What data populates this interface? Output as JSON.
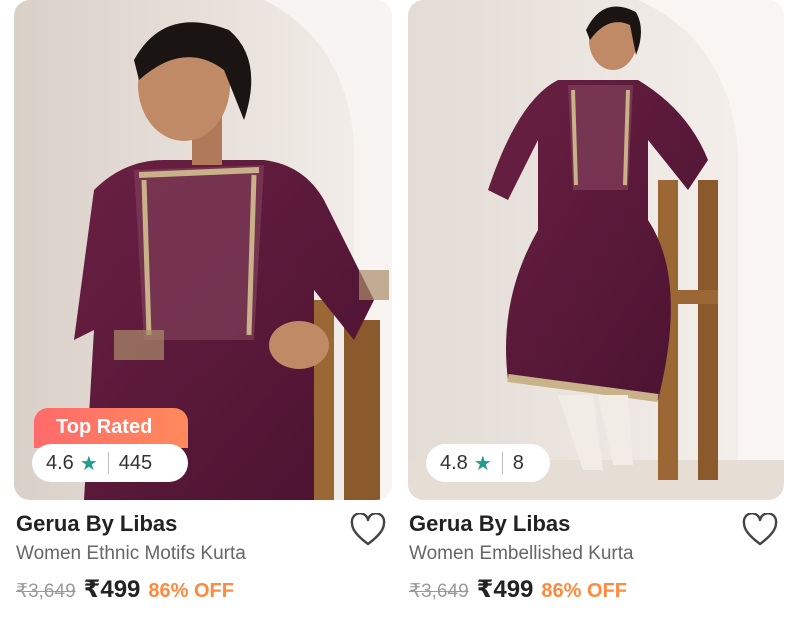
{
  "products": [
    {
      "badge": "Top Rated",
      "rating": "4.6",
      "rating_count": "445",
      "brand": "Gerua By Libas",
      "description": "Women Ethnic Motifs Kurta",
      "mrp": "₹3,649",
      "price": "₹499",
      "discount": "86% OFF",
      "image_alt": "Model wearing a wine embroidered kurta",
      "icons": {
        "rating": "star-icon",
        "wishlist": "heart-outline-icon"
      }
    },
    {
      "rating": "4.8",
      "rating_count": "8",
      "brand": "Gerua By Libas",
      "description": "Women Embellished Kurta",
      "mrp": "₹3,649",
      "price": "₹499",
      "discount": "86% OFF",
      "image_alt": "Model seated in a wine embellished kurta",
      "icons": {
        "rating": "star-icon",
        "wishlist": "heart-outline-icon"
      }
    }
  ],
  "colors": {
    "badge_gradient": [
      "#ff6a6a",
      "#ff8a5c"
    ],
    "star": "#1f9d8f",
    "discount": "#ff8a3d",
    "kurta": "#5e1a3a"
  }
}
